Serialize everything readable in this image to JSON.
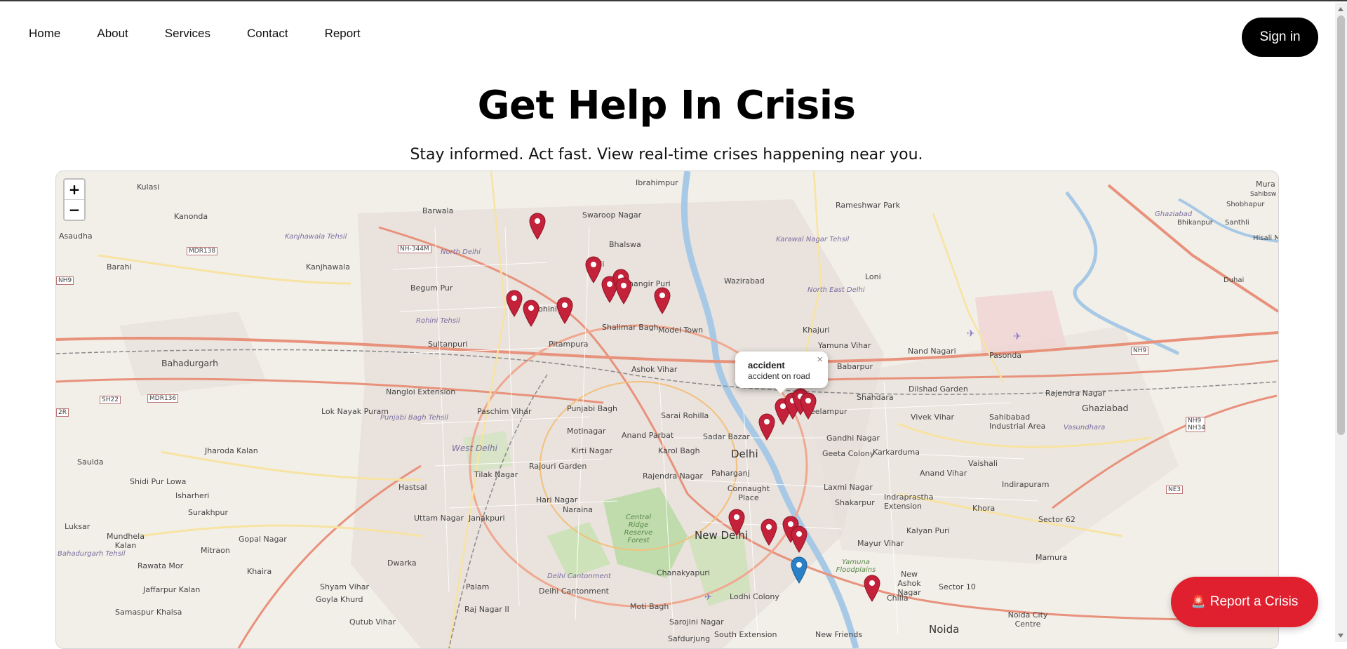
{
  "nav": {
    "items": [
      "Home",
      "About",
      "Services",
      "Contact",
      "Report"
    ],
    "signin_label": "Sign in"
  },
  "hero": {
    "title": "Get Help In Crisis",
    "subtitle": "Stay informed. Act fast. View real-time crises happening near you."
  },
  "map": {
    "zoom_in": "+",
    "zoom_out": "−",
    "labels": {
      "kulasi": "Kulasi",
      "asaudha": "Asaudha",
      "kanonda": "Kanonda",
      "barahi": "Barahi",
      "mdr138": "MDR138",
      "kanjhawala_tehsil": "Kanjhawala Tehsil",
      "kanjhawala": "Kanjhawala",
      "nh344m": "NH-344M",
      "barwala": "Barwala",
      "north_delhi": "North Delhi",
      "begum_pur": "Begum Pur",
      "rohini": "Rohini",
      "rohini_tehsil": "Rohini Tehsil",
      "sultanpuri": "Sultanpuri",
      "pitampura": "Pitampura",
      "swaroop_nagar": "Swaroop Nagar",
      "ibrahimpur": "Ibrahimpur",
      "bhalswa": "Bhalswa",
      "badli": "Badli",
      "jahangir_puri": "Jahangir Puri",
      "shalimar_bagh": "Shalimar Bagh",
      "model_town": "Model Town",
      "wazirabad": "Wazirabad",
      "rameshwar_park": "Rameshwar Park",
      "karawal_nagar_tehsil": "Karawal Nagar Tehsil",
      "north_east_delhi": "North East Delhi",
      "loni": "Loni",
      "khajuri": "Khajuri",
      "yamuna_vihar": "Yamuna Vihar",
      "babarpur": "Babarpur",
      "nand_nagari": "Nand Nagari",
      "pasonda": "Pasonda",
      "nh9_w": "NH9",
      "bahadurgarh": "Bahadurgarh",
      "ashok_vihar": "Ashok Vihar",
      "nangloi_extension": "Nangloi Extension",
      "sh22": "SH22",
      "mdr136": "MDR136",
      "r2": "2R",
      "lok_nayak_puram": "Lok Nayak Puram",
      "punjabi_bagh_tehsil": "Punjabi Bagh Tehsil",
      "paschim_vihar": "Paschim Vihar",
      "punjabi_bagh": "Punjabi Bagh",
      "sarai_rohilla": "Sarai Rohilla",
      "sadar_bazar": "Sadar Bazar",
      "delhi": "Delhi",
      "seelampur": "Seelampur",
      "shahdara": "Shahdara",
      "dilshad_garden": "Dilshad Garden",
      "vivek_vihar": "Vivek Vihar",
      "rajendra_nagar_e": "Rajendra Nagar",
      "sahibabad": "Sahibabad Industrial Area",
      "vasundhara": "Vasundhara",
      "ghaziabad": "Ghaziabad",
      "nh9_e": "NH9",
      "nh9_nh34": "NH9 NH34",
      "jharoda_kalan": "Jharoda Kalan",
      "saulda": "Saulda",
      "west_delhi": "West Delhi",
      "motinagar": "Motinagar",
      "anand_parbat": "Anand Parbat",
      "kirti_nagar": "Kirti Nagar",
      "karol_bagh": "Karol Bagh",
      "gandhi_nagar": "Gandhi Nagar",
      "geeta_colony": "Geeta Colony",
      "karkarduma": "Karkarduma",
      "anand_vihar": "Anand Vihar",
      "vaishali": "Vaishali",
      "indirapuram": "Indirapuram",
      "shidi_pur_lowa": "Shidi Pur Lowa",
      "isharheri": "Isharheri",
      "tilak_nagar": "Tilak Nagar",
      "rajouri_garden": "Rajouri Garden",
      "rajendra_nagar_w": "Rajendra Nagar",
      "paharganj": "Paharganj",
      "connaught_place": "Connaught Place",
      "laxmi_nagar": "Laxmi Nagar",
      "shakarpur": "Shakarpur",
      "indraprastha": "Indraprastha Extension",
      "khora": "Khora",
      "sector62": "Sector 62",
      "ne3": "NE3",
      "hastsal": "Hastsal",
      "hari_nagar": "Hari Nagar",
      "naraina": "Naraina",
      "central_ridge": "Central Ridge Reserve Forest",
      "kalyan_puri": "Kalyan Puri",
      "mayur_vihar": "Mayur Vihar",
      "mamura": "Mamura",
      "luksar": "Luksar",
      "mundhela_kalan": "Mundhela Kalan",
      "surakhpur": "Surakhpur",
      "gopal_nagar": "Gopal Nagar",
      "uttam_nagar": "Uttam Nagar",
      "janakpuri": "Janakpuri",
      "mitraon": "Mitraon",
      "new_delhi": "New Delhi",
      "bahadurgarh_tehsil": "Bahadurgarh Tehsil",
      "rawata_mor": "Rawata Mor",
      "khaira": "Khaira",
      "dwarka": "Dwarka",
      "delhi_cantonment_tehsil": "Delhi Cantonment",
      "chanakyapuri": "Chanakyapuri",
      "yamuna_floodplains": "Yamuna Floodplains",
      "new_ashok_nagar": "New Ashok Nagar",
      "sector10": "Sector 10",
      "shyam_vihar": "Shyam Vihar",
      "palam": "Palam",
      "delhi_cantonment": "Delhi Cantonment",
      "lodhi_colony": "Lodhi Colony",
      "chilla": "Chilla",
      "jaffarpur_kalan": "Jaffarpur Kalan",
      "goyla_khurd": "Goyla Khurd",
      "samaspur_khalsa": "Samaspur Khalsa",
      "qutub_vihar": "Qutub Vihar",
      "raj_nagar_ii": "Raj Nagar II",
      "moti_bagh": "Moti Bagh",
      "sarojini_nagar": "Sarojini Nagar",
      "south_extension": "South Extension",
      "new_friends": "New Friends",
      "noida": "Noida",
      "noida_city_centre": "Noida City Centre",
      "safdurjung": "Safdurjung",
      "mura": "Mura",
      "sahibsw": "Sahibsw",
      "shobhapur": "Shobhapur",
      "bhikanpur": "Bhikanpur",
      "santhli": "Santhli",
      "hisali": "Hisali M",
      "duhai": "Duhai",
      "ghaziabad_river": "Ghaziabad"
    },
    "popup": {
      "title": "accident",
      "description": "accident on road",
      "close": "×"
    },
    "colors": {
      "marker_red": "#c4213a",
      "marker_blue": "#2a80c6",
      "primary_road": "#e8927c",
      "secondary_road": "#f7e3a2",
      "river": "#a7c9e6",
      "park": "#b9d9a3"
    },
    "markers": {
      "red_count": 25,
      "blue_count": 1
    }
  },
  "report_button": {
    "icon": "siren-icon",
    "label": "Report a Crisis"
  }
}
